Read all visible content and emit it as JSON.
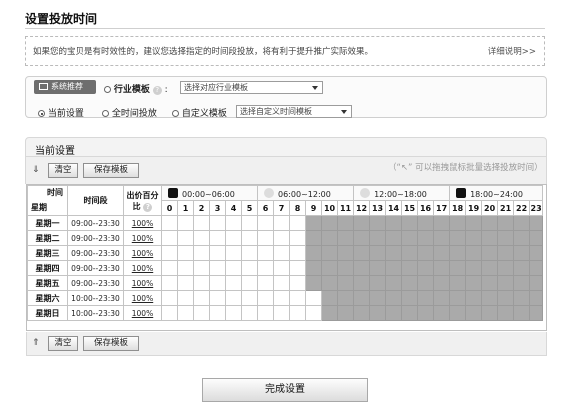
{
  "page": {
    "title": "设置投放时间"
  },
  "notice": {
    "text": "如果您的宝贝是有时效性的，建议您选择指定的时间段投放，将有利于提升推广实际效果。",
    "link": "详细说明>>"
  },
  "template_panel": {
    "badge": "系统推荐",
    "industry_label": "行业模板",
    "industry_placeholder": "选择对应行业模板",
    "current_label": "当前设置",
    "all_time_label": "全时间投放",
    "custom_label": "自定义模板",
    "custom_placeholder": "选择自定义时间模板"
  },
  "current": {
    "title": "当前设置",
    "clear_label": "清空",
    "save_label": "保存模板",
    "hint": "（“↖” 可以拖拽鼠标批量选择投放时间）"
  },
  "grid": {
    "header_time": "时间",
    "header_day": "星期",
    "header_period": "时间段",
    "header_pct": "出价百分比",
    "periods": [
      "00:00~06:00",
      "06:00~12:00",
      "12:00~18:00",
      "18:00~24:00"
    ],
    "hours": [
      "0",
      "1",
      "2",
      "3",
      "4",
      "5",
      "6",
      "7",
      "8",
      "9",
      "10",
      "11",
      "12",
      "13",
      "14",
      "15",
      "16",
      "17",
      "18",
      "19",
      "20",
      "21",
      "22",
      "23"
    ],
    "rows": [
      {
        "day": "星期一",
        "time": "09:00--23:30",
        "pct": "100%",
        "start": 9,
        "end": 23
      },
      {
        "day": "星期二",
        "time": "09:00--23:30",
        "pct": "100%",
        "start": 9,
        "end": 23
      },
      {
        "day": "星期三",
        "time": "09:00--23:30",
        "pct": "100%",
        "start": 9,
        "end": 23
      },
      {
        "day": "星期四",
        "time": "09:00--23:30",
        "pct": "100%",
        "start": 9,
        "end": 23
      },
      {
        "day": "星期五",
        "time": "09:00--23:30",
        "pct": "100%",
        "start": 9,
        "end": 23
      },
      {
        "day": "星期六",
        "time": "10:00--23:30",
        "pct": "100%",
        "start": 10,
        "end": 23
      },
      {
        "day": "星期日",
        "time": "10:00--23:30",
        "pct": "100%",
        "start": 10,
        "end": 23
      }
    ]
  },
  "bottom": {
    "clear_label": "清空",
    "save_label": "保存模板"
  },
  "finish_label": "完成设置"
}
